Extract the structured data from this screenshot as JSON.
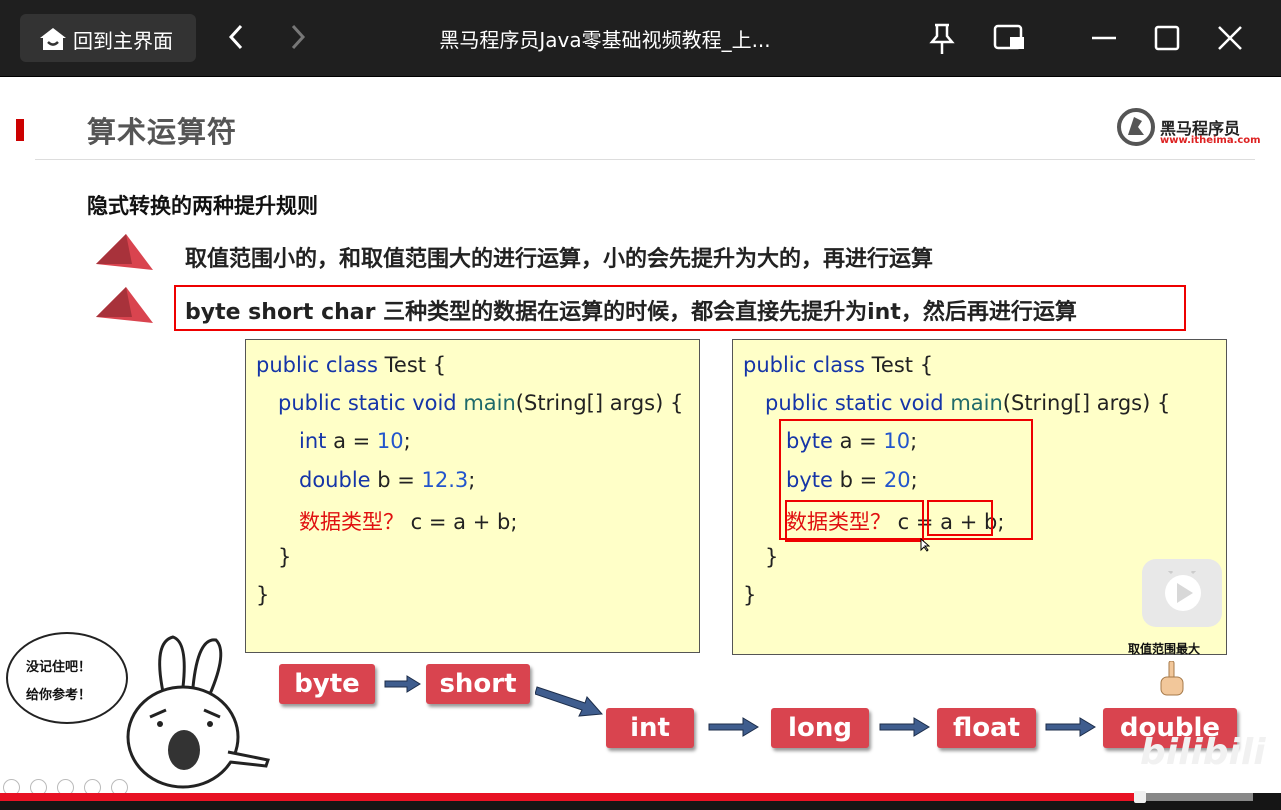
{
  "titlebar": {
    "home_label": "回到主界面",
    "window_title": "黑马程序员Java零基础视频教程_上..."
  },
  "slide": {
    "title": "算术运算符",
    "logo_brand": "黑马程序员",
    "logo_url": "www.itheima.com",
    "subtitle": "隐式转换的两种提升规则",
    "rule1": "取值范围小的，和取值范围大的进行运算，小的会先提升为大的，再进行运算",
    "rule2": "byte short char 三种类型的数据在运算的时候，都会直接先提升为int，然后再进行运算",
    "left_code": {
      "l1_kw": "public class",
      "l1_rest": " Test {",
      "l2_kw": "public static void",
      "l2_fn": " main",
      "l2_rest": "(String[] args) {",
      "l3_kw": "int",
      "l3_mid": " a = ",
      "l3_num": "10",
      "l3_end": ";",
      "l4_kw": "double",
      "l4_mid": " b = ",
      "l4_num": "12.3",
      "l4_end": ";",
      "l5_red": "数据类型？",
      "l5_rest": " c = a + b;",
      "l6": "}",
      "l7": "}"
    },
    "right_code": {
      "l1_kw": "public class",
      "l1_rest": " Test {",
      "l2_kw": "public static void",
      "l2_fn": " main",
      "l2_rest": "(String[] args) {",
      "l3_kw": "byte",
      "l3_mid": " a = ",
      "l3_num": "10",
      "l3_end": ";",
      "l4_kw": "byte",
      "l4_mid": " b = ",
      "l4_num": "20",
      "l4_end": ";",
      "l5_red": "数据类型？",
      "l5_mid": " c = ",
      "l5_expr": "a + b;",
      "l6": "}",
      "l7": "}"
    },
    "type_chain": [
      "byte",
      "short",
      "int",
      "long",
      "float",
      "double"
    ],
    "range_label": "取值范围最大",
    "bubble_line1": "没记住吧！",
    "bubble_line2": "给你参考！",
    "watermark": "bilibili"
  },
  "player": {
    "progress": 0.888,
    "buffered": 0.978
  },
  "colors": {
    "accent_red": "#d9444f",
    "highlight_red": "#e00000",
    "code_bg": "#ffffc8",
    "keyword_blue": "#1535a8"
  }
}
